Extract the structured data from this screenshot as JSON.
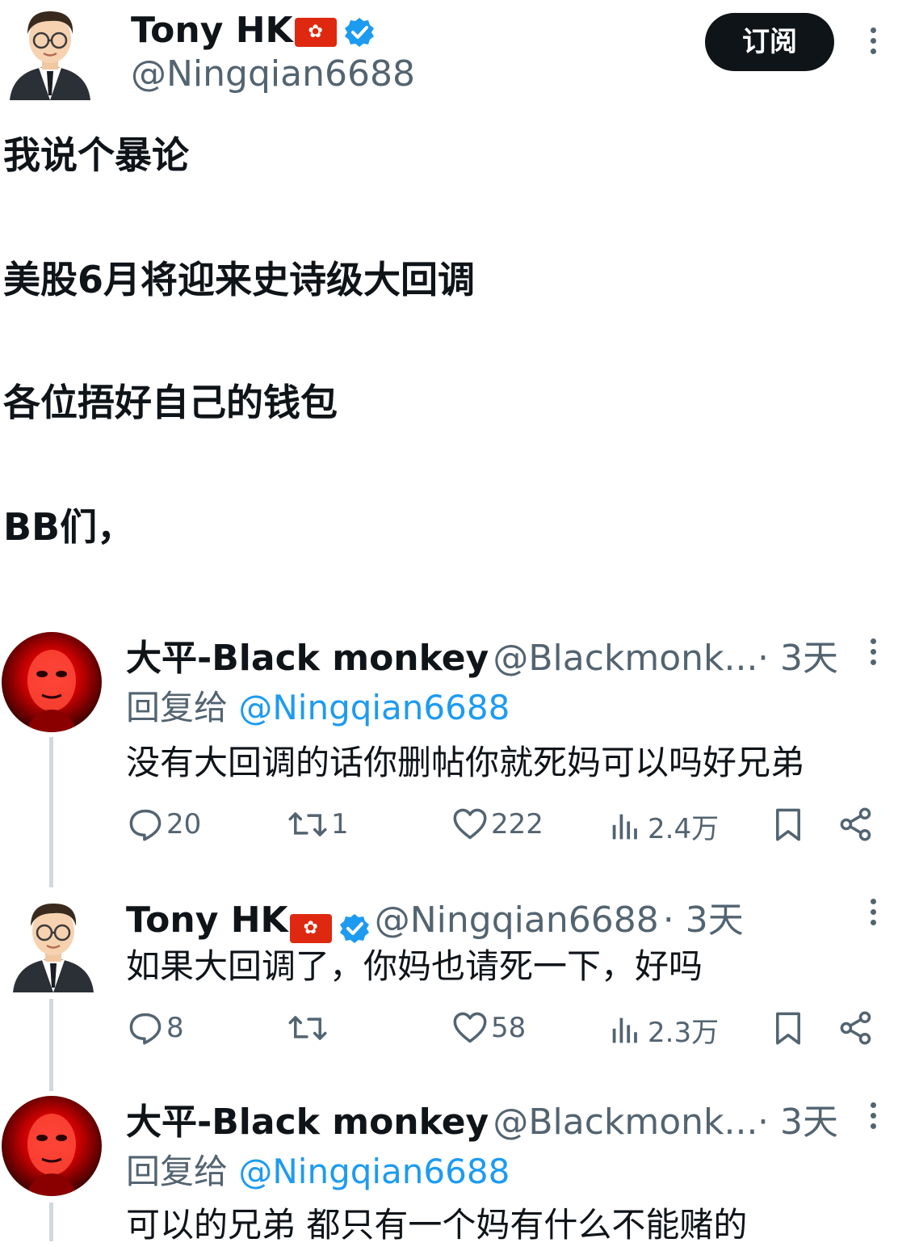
{
  "main_tweet": {
    "author_name": "Tony HK",
    "flag_glyph": "✿",
    "handle": "@Ningqian6688",
    "subscribe_label": "订阅",
    "lines": [
      "我说个暴论",
      "美股6月将迎来史诗级大回调",
      "各位捂好自己的钱包",
      "BB们，"
    ]
  },
  "replies": [
    {
      "author_name": "大平-Black monkey",
      "handle": "@Blackmonk...",
      "time": "· 3天",
      "reply_to_prefix": "回复给 ",
      "reply_to_handle": "@Ningqian6688",
      "text": "没有大回调的话你删帖你就死妈可以吗好兄弟",
      "stats": {
        "replies": "20",
        "retweets": "1",
        "likes": "222",
        "views": "2.4万"
      }
    },
    {
      "author_name": "Tony HK",
      "handle": "@Ningqian6688",
      "time": "· 3天",
      "text": "如果大回调了，你妈也请死一下，好吗",
      "stats": {
        "replies": "8",
        "retweets": "",
        "likes": "58",
        "views": "2.3万"
      }
    },
    {
      "author_name": "大平-Black monkey",
      "handle": "@Blackmonk...",
      "time": "· 3天",
      "reply_to_prefix": "回复给 ",
      "reply_to_handle": "@Ningqian6688",
      "text": "可以的兄弟 都只有一个妈有什么不能赌的"
    }
  ],
  "colors": {
    "text": "#0f1419",
    "secondary": "#536471",
    "link": "#1d9bf0",
    "flag_red": "#de2910"
  }
}
